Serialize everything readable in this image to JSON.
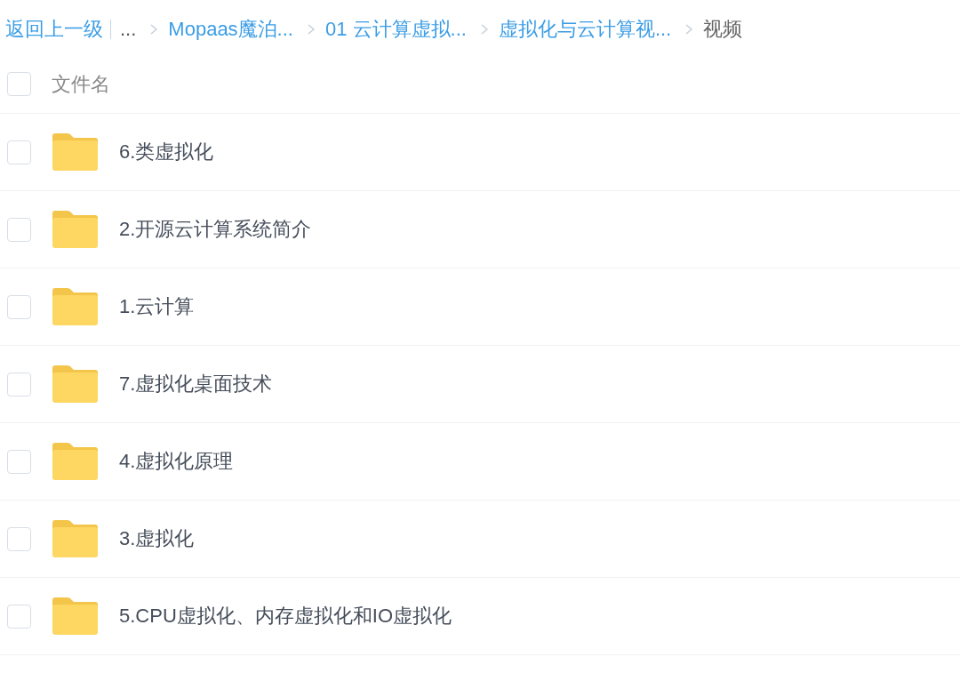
{
  "breadcrumb": {
    "back": "返回上一级",
    "items": [
      {
        "kind": "ellipsis",
        "label": "..."
      },
      {
        "kind": "link",
        "label": "Mopaas魔泊..."
      },
      {
        "kind": "link",
        "label": "01 云计算虚拟..."
      },
      {
        "kind": "link",
        "label": "虚拟化与云计算视..."
      },
      {
        "kind": "current",
        "label": "视频"
      }
    ]
  },
  "header": {
    "checked": false,
    "column": "文件名"
  },
  "files": [
    {
      "name": "6.类虚拟化",
      "checked": false
    },
    {
      "name": "2.开源云计算系统简介",
      "checked": false
    },
    {
      "name": "1.云计算",
      "checked": false
    },
    {
      "name": "7.虚拟化桌面技术",
      "checked": false
    },
    {
      "name": "4.虚拟化原理",
      "checked": false
    },
    {
      "name": "3.虚拟化",
      "checked": false
    },
    {
      "name": "5.CPU虚拟化、内存虚拟化和IO虚拟化",
      "checked": false
    }
  ]
}
